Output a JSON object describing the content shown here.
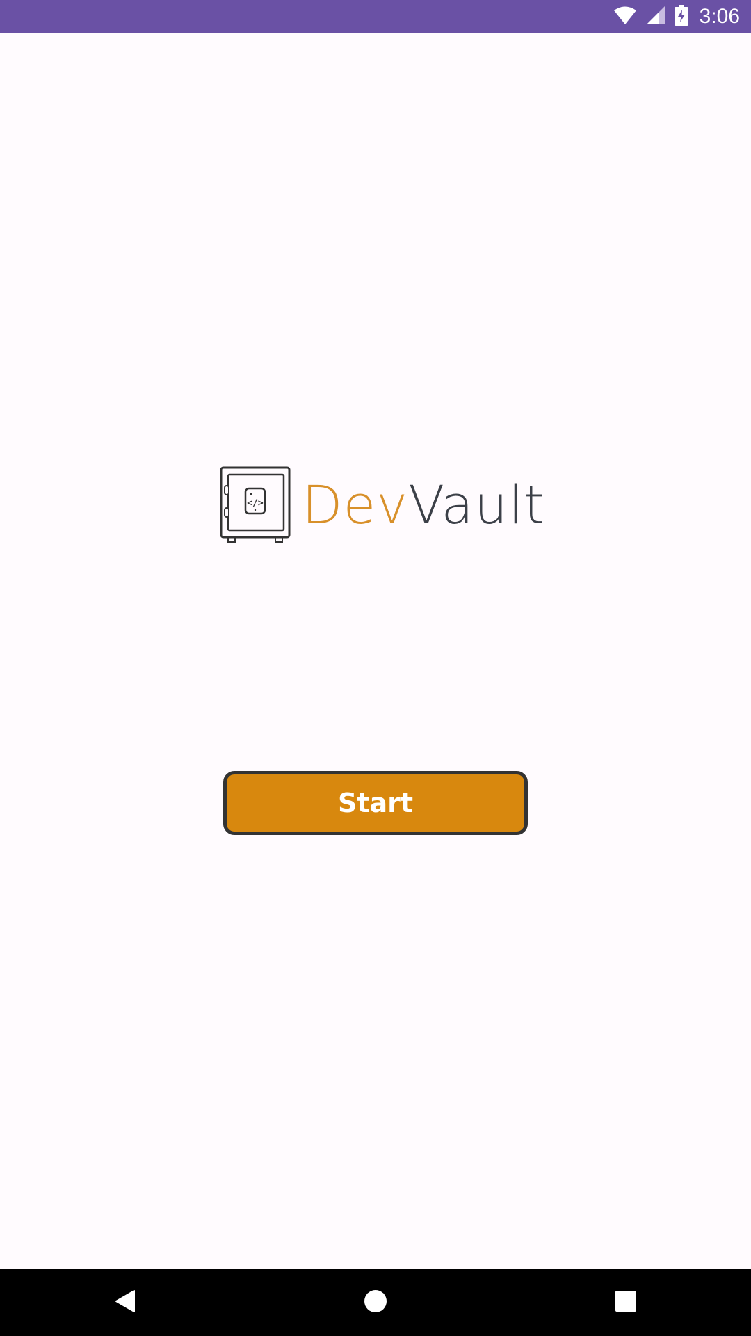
{
  "status_bar": {
    "time": "3:06",
    "bg_color": "#6a51a5",
    "icons": [
      "wifi-icon",
      "signal-icon",
      "battery-charging-icon"
    ]
  },
  "logo": {
    "icon": "safe-code-icon",
    "text_part1": "Dev",
    "text_part2": "Vault",
    "color_part1": "#d8902a",
    "color_part2": "#3c4048"
  },
  "start_button": {
    "label": "Start",
    "bg_color": "#d8880e",
    "border_color": "#333333"
  },
  "nav_bar": {
    "buttons": [
      "back-icon",
      "home-icon",
      "recents-icon"
    ]
  }
}
